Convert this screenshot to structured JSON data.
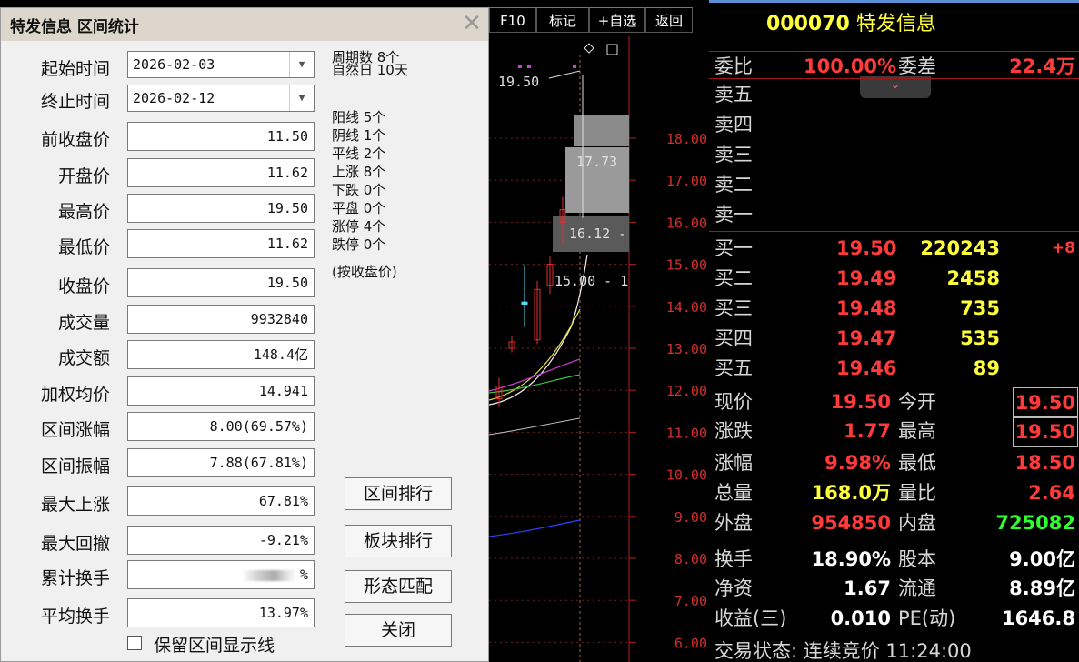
{
  "dialog": {
    "title": "特发信息 区间统计",
    "start_label": "起始时间",
    "start_value": "2026-02-03",
    "end_label": "终止时间",
    "end_value": "2026-02-12",
    "fields": [
      {
        "label": "前收盘价",
        "value": "11.50"
      },
      {
        "label": "开盘价",
        "value": "11.62"
      },
      {
        "label": "最高价",
        "value": "19.50"
      },
      {
        "label": "最低价",
        "value": "11.62"
      },
      {
        "label": "收盘价",
        "value": "19.50"
      },
      {
        "label": "成交量",
        "value": "9932840"
      },
      {
        "label": "成交额",
        "value": "148.4亿"
      },
      {
        "label": "加权均价",
        "value": "14.941"
      },
      {
        "label": "区间涨幅",
        "value": "8.00(69.57%)"
      },
      {
        "label": "区间振幅",
        "value": "7.88(67.81%)"
      },
      {
        "label": "最大上涨",
        "value": "67.81%"
      },
      {
        "label": "最大回撤",
        "value": "-9.21%"
      },
      {
        "label": "累计换手",
        "value": "%"
      },
      {
        "label": "平均换手",
        "value": "13.97%"
      }
    ],
    "period_count": "周期数 8个",
    "natural_days": "自然日 10天",
    "stats": [
      "阳线 5个",
      "阴线 1个",
      "平线 2个",
      "上涨 8个",
      "下跌 0个",
      "平盘 0个",
      "涨停 4个",
      "跌停 0个"
    ],
    "stats_note": "(按收盘价)",
    "buttons": {
      "rank": "区间排行",
      "sector_rank": "板块排行",
      "pattern": "形态匹配",
      "close": "关闭"
    },
    "keep_line_label": "保留区间显示线",
    "keep_line_checked": false
  },
  "toolbar": {
    "f10": "F10",
    "mark": "标记",
    "add_watch": "+自选",
    "back": "返回"
  },
  "chart_data": {
    "type": "candlestick",
    "y_ticks": [
      "18.00",
      "17.00",
      "16.00",
      "15.00",
      "14.00",
      "13.00",
      "12.00",
      "11.00",
      "10.00",
      "9.00",
      "8.00",
      "7.00",
      "6.00"
    ],
    "annotations": [
      "19.50",
      "17.73",
      "16.12 -",
      "15.00 - 1"
    ],
    "ylim": [
      6,
      19.8
    ]
  },
  "quote": {
    "code": "000070",
    "name": "特发信息",
    "weibi_label": "委比",
    "weibi_value": "100.00%",
    "weicha_label": "委差",
    "weicha_value": "22.4万",
    "sell": [
      {
        "label": "卖五"
      },
      {
        "label": "卖四"
      },
      {
        "label": "卖三"
      },
      {
        "label": "卖二"
      },
      {
        "label": "卖一"
      }
    ],
    "buy": [
      {
        "label": "买一",
        "price": "19.50",
        "vol": "220243",
        "chg": "+8"
      },
      {
        "label": "买二",
        "price": "19.49",
        "vol": "2458",
        "chg": ""
      },
      {
        "label": "买三",
        "price": "19.48",
        "vol": "735",
        "chg": ""
      },
      {
        "label": "买四",
        "price": "19.47",
        "vol": "535",
        "chg": ""
      },
      {
        "label": "买五",
        "price": "19.46",
        "vol": "89",
        "chg": ""
      }
    ],
    "stats": [
      {
        "l1": "现价",
        "v1": "19.50",
        "l2": "今开",
        "v2": "19.50"
      },
      {
        "l1": "涨跌",
        "v1": "1.77",
        "l2": "最高",
        "v2": "19.50"
      },
      {
        "l1": "涨幅",
        "v1": "9.98%",
        "l2": "最低",
        "v2": "18.50"
      },
      {
        "l1": "总量",
        "v1": "168.0万",
        "l2": "量比",
        "v2": "2.64"
      },
      {
        "l1": "外盘",
        "v1": "954850",
        "l2": "内盘",
        "v2": "725082"
      },
      {
        "l1": "换手",
        "v1": "18.90%",
        "l2": "股本",
        "v2": "9.00亿"
      },
      {
        "l1": "净资",
        "v1": "1.67",
        "l2": "流通",
        "v2": "8.89亿"
      },
      {
        "l1": "收益(三)",
        "v1": "0.010",
        "l2": "PE(动)",
        "v2": "1646.8"
      }
    ],
    "status": "交易状态: 连续竞价 11:24:00"
  }
}
